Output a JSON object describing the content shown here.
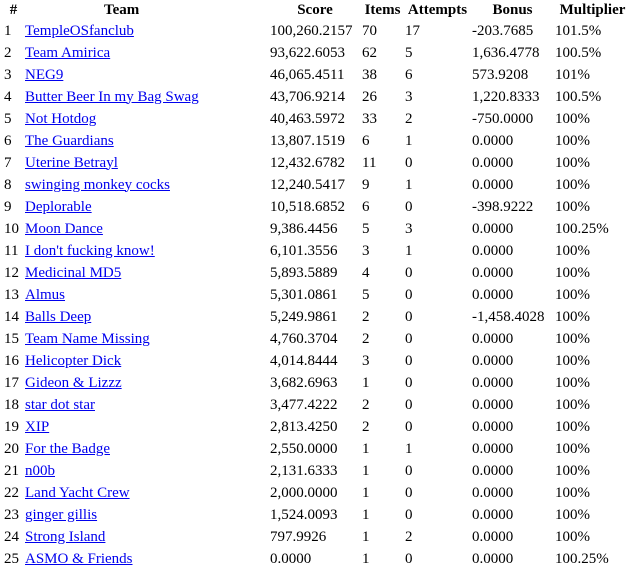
{
  "headers": [
    "#",
    "Team",
    "Score",
    "Items",
    "Attempts",
    "Bonus",
    "Multiplier"
  ],
  "link_color": "#0000ee",
  "rows": [
    [
      "1",
      "TempleOSfanclub",
      "100,260.2157",
      "70",
      "17",
      "-203.7685",
      "101.5%"
    ],
    [
      "2",
      "Team Amirica",
      "93,622.6053",
      "62",
      "5",
      "1,636.4778",
      "100.5%"
    ],
    [
      "3",
      "NEG9",
      "46,065.4511",
      "38",
      "6",
      "573.9208",
      "101%"
    ],
    [
      "4",
      "Butter Beer In my Bag Swag",
      "43,706.9214",
      "26",
      "3",
      "1,220.8333",
      "100.5%"
    ],
    [
      "5",
      "Not Hotdog",
      "40,463.5972",
      "33",
      "2",
      "-750.0000",
      "100%"
    ],
    [
      "6",
      "The Guardians",
      "13,807.1519",
      "6",
      "1",
      "0.0000",
      "100%"
    ],
    [
      "7",
      "Uterine Betrayl",
      "12,432.6782",
      "11",
      "0",
      "0.0000",
      "100%"
    ],
    [
      "8",
      "swinging monkey cocks",
      "12,240.5417",
      "9",
      "1",
      "0.0000",
      "100%"
    ],
    [
      "9",
      "Deplorable",
      "10,518.6852",
      "6",
      "0",
      "-398.9222",
      "100%"
    ],
    [
      "10",
      "Moon Dance",
      "9,386.4456",
      "5",
      "3",
      "0.0000",
      "100.25%"
    ],
    [
      "11",
      "I don't fucking know!",
      "6,101.3556",
      "3",
      "1",
      "0.0000",
      "100%"
    ],
    [
      "12",
      "Medicinal MD5",
      "5,893.5889",
      "4",
      "0",
      "0.0000",
      "100%"
    ],
    [
      "13",
      "Almus",
      "5,301.0861",
      "5",
      "0",
      "0.0000",
      "100%"
    ],
    [
      "14",
      "Balls Deep",
      "5,249.9861",
      "2",
      "0",
      "-1,458.4028",
      "100%"
    ],
    [
      "15",
      "Team Name Missing",
      "4,760.3704",
      "2",
      "0",
      "0.0000",
      "100%"
    ],
    [
      "16",
      "Helicopter Dick",
      "4,014.8444",
      "3",
      "0",
      "0.0000",
      "100%"
    ],
    [
      "17",
      "Gideon & Lizzz",
      "3,682.6963",
      "1",
      "0",
      "0.0000",
      "100%"
    ],
    [
      "18",
      "star dot star",
      "3,477.4222",
      "2",
      "0",
      "0.0000",
      "100%"
    ],
    [
      "19",
      "XIP",
      "2,813.4250",
      "2",
      "0",
      "0.0000",
      "100%"
    ],
    [
      "20",
      "For the Badge",
      "2,550.0000",
      "1",
      "1",
      "0.0000",
      "100%"
    ],
    [
      "21",
      "n00b",
      "2,131.6333",
      "1",
      "0",
      "0.0000",
      "100%"
    ],
    [
      "22",
      "Land Yacht Crew",
      "2,000.0000",
      "1",
      "0",
      "0.0000",
      "100%"
    ],
    [
      "23",
      "ginger gillis",
      "1,524.0093",
      "1",
      "0",
      "0.0000",
      "100%"
    ],
    [
      "24",
      "Strong Island",
      "797.9926",
      "1",
      "2",
      "0.0000",
      "100%"
    ],
    [
      "25",
      "ASMO & Friends",
      "0.0000",
      "1",
      "0",
      "0.0000",
      "100.25%"
    ]
  ]
}
